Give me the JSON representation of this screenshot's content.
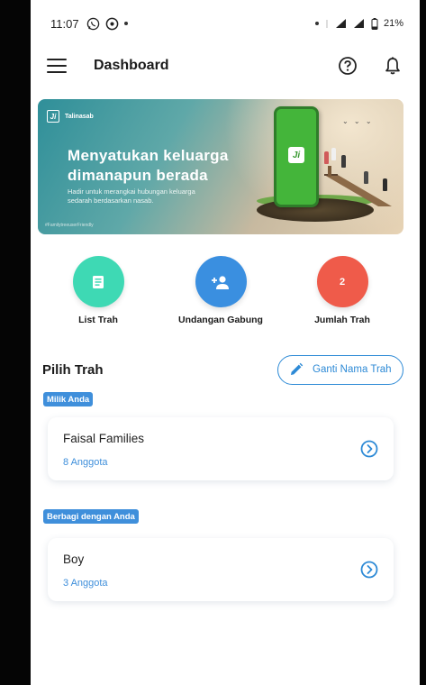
{
  "status_bar": {
    "time": "11:07",
    "battery": "21%"
  },
  "app_bar": {
    "title": "Dashboard",
    "menu_icon": "menu-icon",
    "help_icon": "help-circle-icon",
    "bell_icon": "bell-icon"
  },
  "banner": {
    "brand": "Talinasab",
    "headline_1": "Menyatukan keluarga",
    "headline_2": "dimanapun berada",
    "subline_1": "Hadir untuk merangkai hubungan keluarga",
    "subline_2": "sedarah berdasarkan nasab.",
    "hashtag": "#FamilytreeuserFriendly"
  },
  "shortcuts": [
    {
      "label": "List Trah",
      "icon": "list-icon",
      "color": "#3ed9b4"
    },
    {
      "label": "Undangan Gabung",
      "icon": "add-person-icon",
      "color": "#3a8fe0"
    },
    {
      "label": "Jumlah Trah",
      "value": "2",
      "color": "#ef5b4a"
    }
  ],
  "section": {
    "title": "Pilih Trah",
    "rename_button": "Ganti Nama Trah"
  },
  "groups": [
    {
      "chip": "Milik Anda",
      "items": [
        {
          "name": "Faisal Families",
          "count": "8 Anggota"
        }
      ]
    },
    {
      "chip": "Berbagi dengan Anda",
      "items": [
        {
          "name": "Boy",
          "count": "3 Anggota"
        }
      ]
    }
  ],
  "colors": {
    "accent": "#3f8fdb",
    "teal": "#3ed9b4",
    "red": "#ef5b4a"
  }
}
